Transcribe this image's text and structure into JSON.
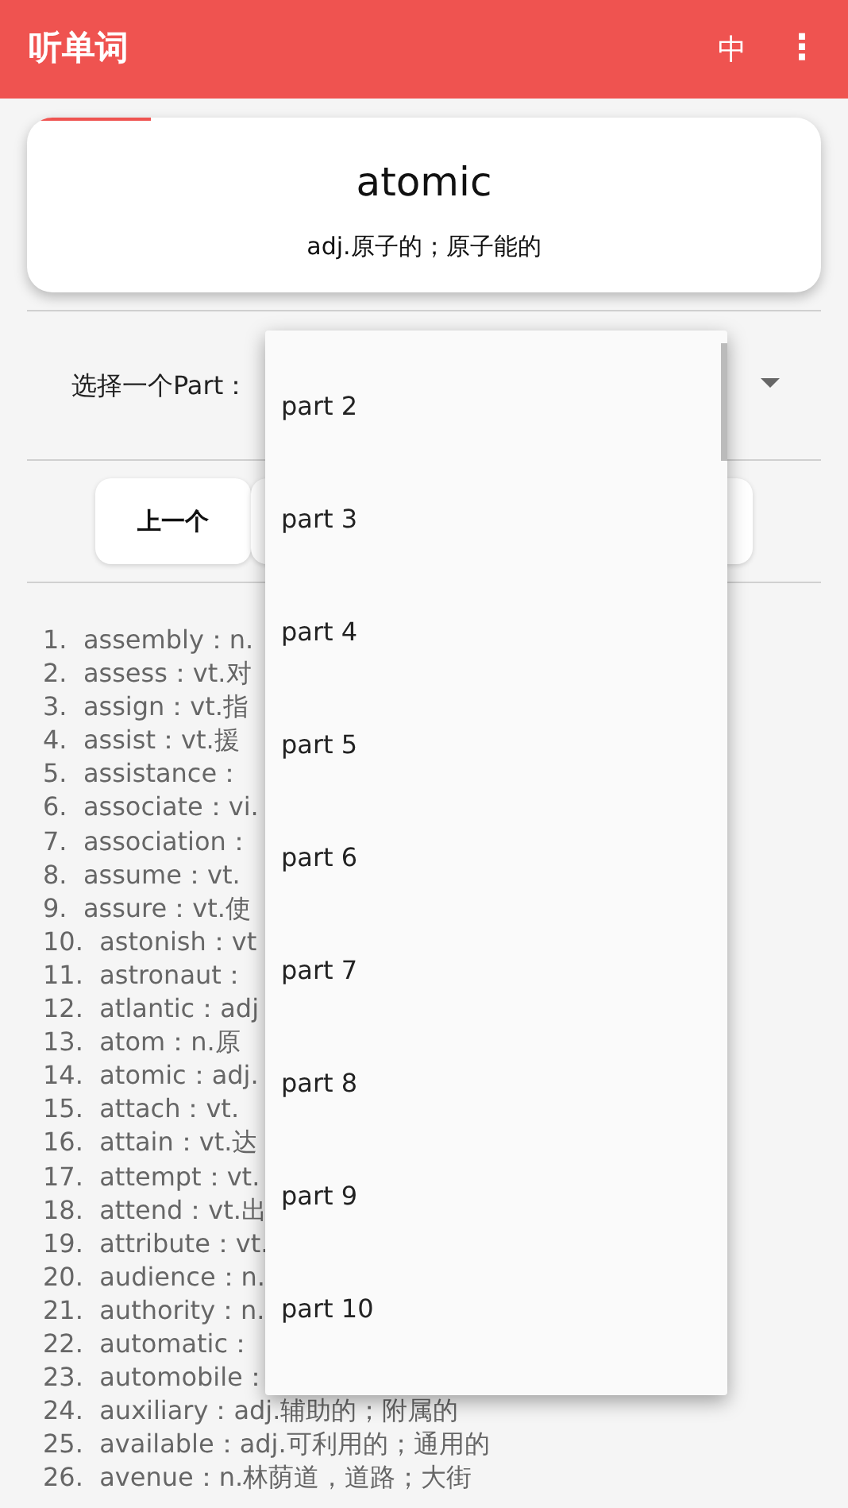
{
  "app_bar": {
    "title": "听单词",
    "language_button": "中",
    "menu": "⋮"
  },
  "word_card": {
    "word": "atomic",
    "definition": "adj.原子的；原子能的",
    "progress": {
      "level": 0.156
    }
  },
  "part_selector": {
    "label": "选择一个Part：",
    "expanded": true,
    "options": [
      {
        "label": "part 2",
        "selected": false
      },
      {
        "label": "part 3",
        "selected": false
      },
      {
        "label": "part 4",
        "selected": false
      },
      {
        "label": "part 5",
        "selected": false
      },
      {
        "label": "part 6",
        "selected": false
      },
      {
        "label": "part 7",
        "selected": false
      },
      {
        "label": "part 8",
        "selected": false
      },
      {
        "label": "part 9",
        "selected": false
      },
      {
        "label": "part 10",
        "selected": false
      }
    ]
  },
  "previous_button": "上一个",
  "word_list": [
    "1.  assembly：n.",
    "2.  assess：vt.对",
    "3.  assign：vt.指",
    "4.  assist：vt.援",
    "5.  assistance：",
    "6.  associate：vi.",
    "7.  association：",
    "8.  assume：vt.",
    "9.  assure：vt.使",
    "10.  astonish：vt",
    "11.  astronaut：",
    "12.  atlantic：adj",
    "13.  atom：n.原",
    "14.  atomic：adj.",
    "15.  attach：vt.",
    "16.  attain：vt.达",
    "17.  attempt：vt.",
    "18.  attend：vt.出",
    "19.  attribute：vt.",
    "20.  audience：n.",
    "21.  authority：n.",
    "22.  automatic：",
    "23.  automobile：",
    "24.  auxiliary：adj.辅助的；附属的",
    "25.  available：adj.可利用的；通用的",
    "26.  avenue：n.林荫道，道路；大街"
  ]
}
